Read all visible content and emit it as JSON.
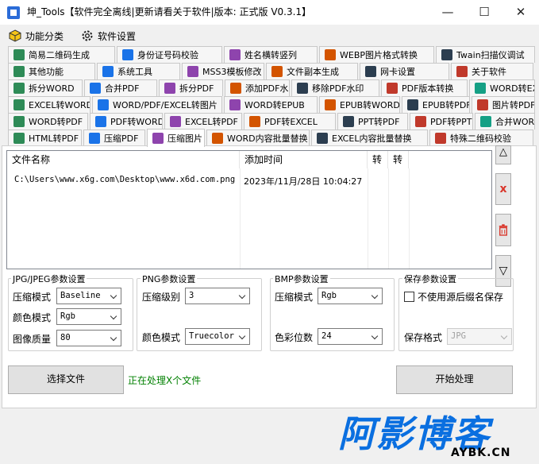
{
  "window": {
    "title": "坤_Tools【软件完全离线|更新请看关于软件|版本: 正式版 V0.3.1】",
    "minimize": "—",
    "maximize": "☐",
    "close": "✕"
  },
  "menu": [
    {
      "label": "功能分类",
      "icon": "cube-icon"
    },
    {
      "label": "软件设置",
      "icon": "gear-icon"
    }
  ],
  "tabs": {
    "row1": [
      "简易二维码生成",
      "身份证号码校验",
      "姓名横转竖列",
      "WEBP图片格式转换",
      "Twain扫描仪调试"
    ],
    "row2": [
      "其他功能",
      "系统工具",
      "MSS3模板修改",
      "文件副本生成",
      "网卡设置",
      "关于软件"
    ],
    "row3": [
      "拆分WORD",
      "合并PDF",
      "拆分PDF",
      "添加PDF水印",
      "移除PDF水印",
      "PDF版本转换",
      "WORD转EXCEL"
    ],
    "row4": [
      "EXCEL转WORD",
      "WORD/PDF/EXCEL转图片",
      "WORD转EPUB",
      "EPUB转WORD",
      "EPUB转PDF",
      "图片转PDF"
    ],
    "row5": [
      "WORD转PDF",
      "PDF转WORD",
      "EXCEL转PDF",
      "PDF转EXCEL",
      "PPT转PDF",
      "PDF转PPT",
      "合并WORD"
    ],
    "row6": [
      "HTML转PDF",
      "压缩PDF",
      "压缩图片",
      "WORD内容批量替换",
      "EXCEL内容批量替换",
      "特殊二维码校验"
    ],
    "active": "压缩图片"
  },
  "file_list": {
    "columns": [
      "文件名称",
      "添加时间",
      "转",
      "转"
    ],
    "rows": [
      {
        "name": "C:\\Users\\www.x6g.com\\Desktop\\www.x6d.com.png",
        "time": "2023年/11月/28日 10:04:27"
      }
    ]
  },
  "side_buttons": {
    "up": "△",
    "remove": "x",
    "clear": "trash-icon",
    "down": "▽"
  },
  "jpg": {
    "title": "JPG/JPEG参数设置",
    "mode_label": "压缩模式",
    "mode": "Baseline",
    "color_label": "颜色模式",
    "color": "Rgb",
    "quality_label": "图像质量",
    "quality": "80"
  },
  "png": {
    "title": "PNG参数设置",
    "level_label": "压缩级别",
    "level": "3",
    "color_label": "颜色模式",
    "color": "Truecolor"
  },
  "bmp": {
    "title": "BMP参数设置",
    "mode_label": "压缩模式",
    "mode": "Rgb",
    "depth_label": "色彩位数",
    "depth": "24"
  },
  "save": {
    "title": "保存参数设置",
    "keep_ext_label": "不使用源后缀名保存",
    "keep_ext_checked": false,
    "format_label": "保存格式",
    "format": "JPG"
  },
  "actions": {
    "choose": "选择文件",
    "status": "正在处理X个文件",
    "start": "开始处理"
  },
  "watermark": {
    "main": "阿影博客",
    "sub": "AYBK.CN"
  },
  "colors": {
    "accent": "#1a73e8",
    "status_text": "#008000",
    "delete": "#d9362b",
    "watermark": "#0a6fe0"
  }
}
